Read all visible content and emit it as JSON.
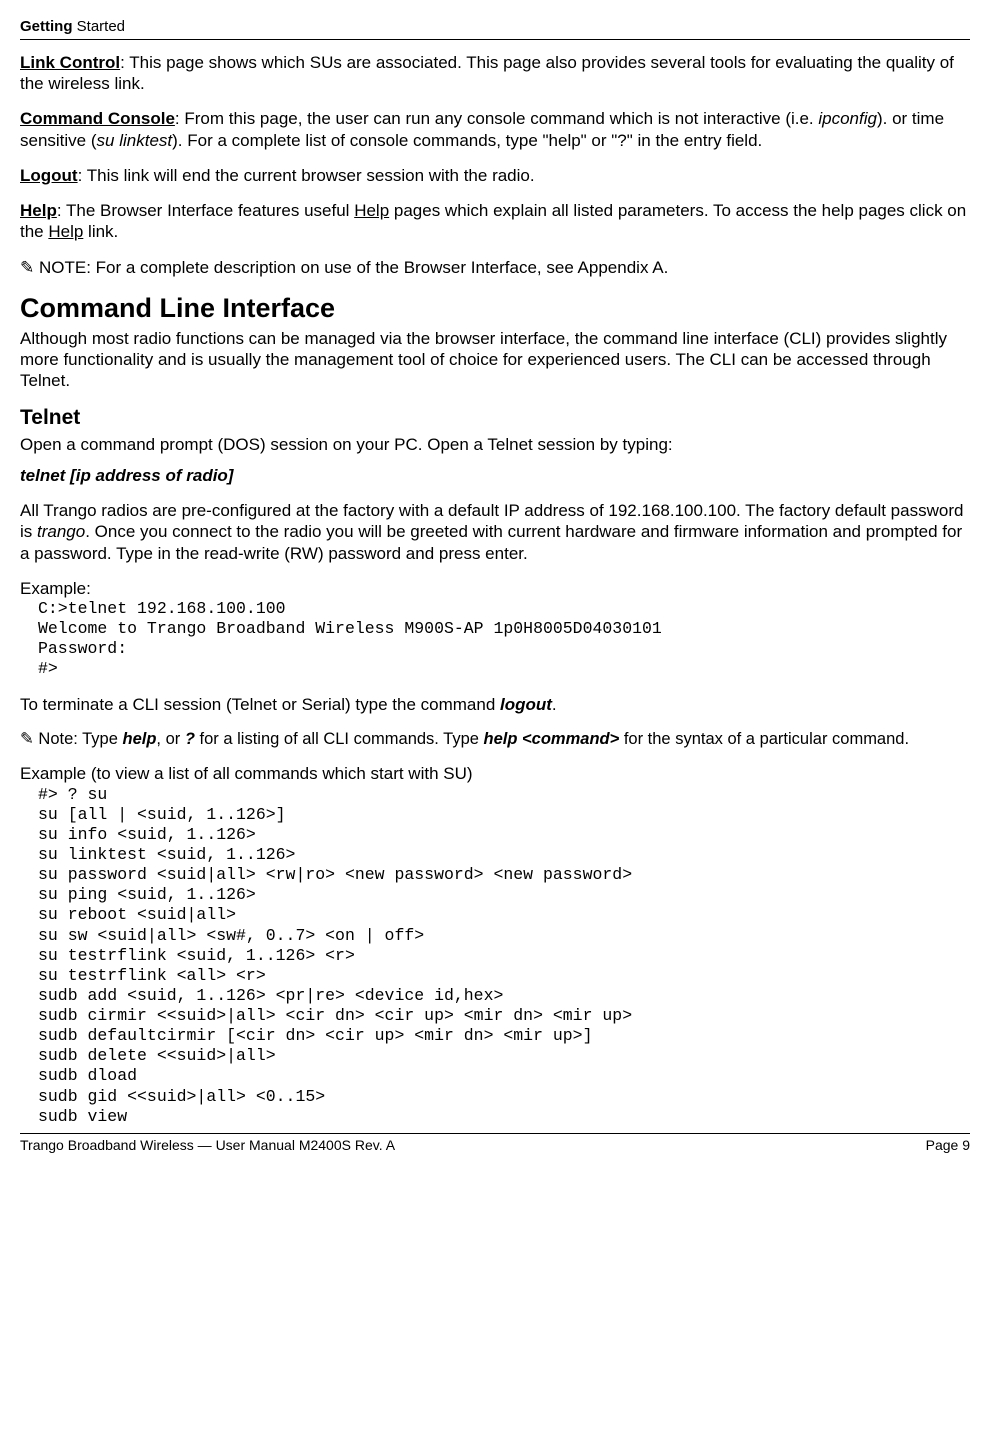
{
  "header": {
    "bold": "Getting",
    "rest": " Started"
  },
  "sections": {
    "link_control_label": "Link Control",
    "link_control_text": ":  This page shows which SUs are associated.  This page also provides several tools for evaluating the quality of the wireless link.",
    "command_console_label": "Command Console",
    "command_console_pre": ":  From this page, the user can run any console command which is not interactive (i.e. ",
    "command_console_i1": "ipconfig",
    "command_console_mid": ").  or time sensitive (",
    "command_console_i2": "su linktest",
    "command_console_post": ").   For a complete list of console commands, type \"help\" or \"?\" in the entry field.",
    "logout_label": "Logout",
    "logout_text": ":   This link will end the current browser session with the radio.",
    "help_label": "Help",
    "help_pre": ":    The Browser Interface features useful ",
    "help_u1": "Help",
    "help_mid": " pages which explain all listed parameters.  To access the help pages click on the ",
    "help_u2": "Help",
    "help_post": " link.",
    "note1": "✎ NOTE:  For a complete description on use of the Browser Interface, see Appendix A.",
    "hcli": "Command Line Interface",
    "cli_para": "Although most radio functions can be managed via the browser interface, the command line interface (CLI) provides slightly more functionality and is usually the management tool of choice for experienced users.  The CLI can be accessed through Telnet.",
    "htelnet": "Telnet",
    "telnet_para": "Open a command prompt (DOS) session on your PC.  Open a Telnet session by typing:",
    "telnet_cmd": "telnet [ip address of radio]",
    "telnet_desc_pre": "All Trango radios are pre-configured at the factory with a default IP address of 192.168.100.100.   The factory default password is ",
    "telnet_desc_i": "trango",
    "telnet_desc_post": ".  Once you connect to the radio you will be greeted with current hardware and firmware information and prompted for a password.  Type in the read-write (RW) password and press enter.",
    "example_label": "Example:",
    "example_code": "C:>telnet 192.168.100.100\nWelcome to Trango Broadband Wireless M900S-AP 1p0H8005D04030101\nPassword:\n#>",
    "terminate_pre": "To terminate a CLI session (Telnet or Serial) type the command ",
    "terminate_bi": "logout",
    "terminate_post": ".",
    "note2_pre": "✎  Note:  Type ",
    "note2_b1": "help",
    "note2_mid1": ", or ",
    "note2_b2": "?",
    "note2_mid2": " for a listing of all CLI commands.  Type ",
    "note2_b3": "help <command>",
    "note2_post": " for the syntax of a particular command.",
    "example2_label": "Example (to view a list of all commands which start with SU)",
    "example2_code": "#> ? su\nsu [all | <suid, 1..126>]\nsu info <suid, 1..126>\nsu linktest <suid, 1..126>\nsu password <suid|all> <rw|ro> <new password> <new password>\nsu ping <suid, 1..126>\nsu reboot <suid|all>\nsu sw <suid|all> <sw#, 0..7> <on | off>\nsu testrflink <suid, 1..126> <r>\nsu testrflink <all> <r>\nsudb add <suid, 1..126> <pr|re> <device id,hex>\nsudb cirmir <<suid>|all> <cir dn> <cir up> <mir dn> <mir up>\nsudb defaultcirmir [<cir dn> <cir up> <mir dn> <mir up>]\nsudb delete <<suid>|all>\nsudb dload\nsudb gid <<suid>|all> <0..15>\nsudb view"
  },
  "footer": {
    "left": "Trango Broadband Wireless — User Manual M2400S  Rev. A",
    "right": "Page 9"
  }
}
